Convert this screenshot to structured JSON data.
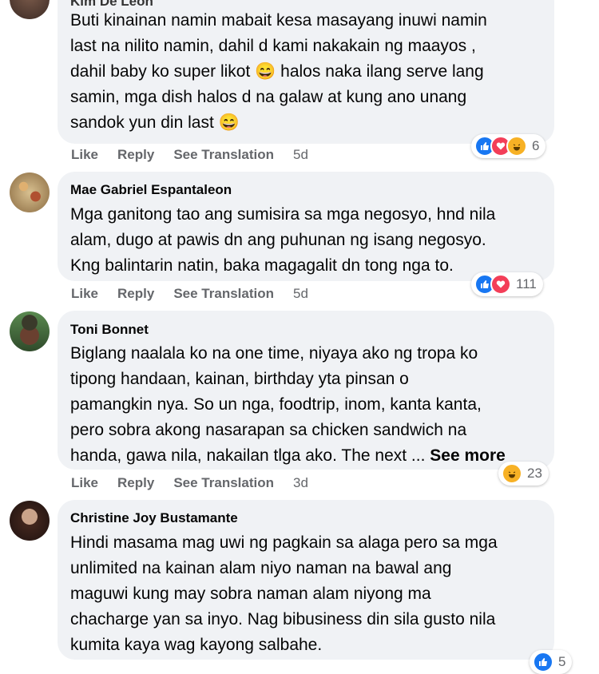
{
  "comments": [
    {
      "author": "Kim De Leon",
      "lines": [
        "Buti kinainan namin mabait kesa masayang inuwi namin",
        "last na nilito namin, dahil d kami nakakain ng maayos ,",
        "dahil baby ko super likot",
        "halos naka ilang serve lang",
        "samin, mga dish halos d na galaw at kung ano unang",
        "sandok yun din last"
      ],
      "like": "Like",
      "reply": "Reply",
      "translate": "See Translation",
      "time": "5d",
      "reactions": [
        "like-icon",
        "love-icon",
        "haha-icon"
      ],
      "count": "6"
    },
    {
      "author": "Mae Gabriel Espantaleon",
      "lines": [
        "Mga ganitong tao ang sumisira sa mga negosyo, hnd nila",
        "alam, dugo at pawis dn ang puhunan ng isang negosyo.",
        "Kng balintarin natin, baka magagalit dn tong nga to."
      ],
      "like": "Like",
      "reply": "Reply",
      "translate": "See Translation",
      "time": "5d",
      "reactions": [
        "like-icon",
        "love-icon"
      ],
      "count": "111"
    },
    {
      "author": "Toni Bonnet",
      "lines": [
        "Biglang naalala ko na one time, niyaya ako ng tropa ko",
        "tipong handaan, kainan, birthday yta pinsan o",
        "pamangkin nya. So un nga, foodtrip, inom, kanta kanta,",
        "pero sobra akong nasarapan sa chicken sandwich na",
        "handa, gawa nila, nakailan tlga ako. The next ..."
      ],
      "see_more": "See more",
      "like": "Like",
      "reply": "Reply",
      "translate": "See Translation",
      "time": "3d",
      "reactions": [
        "haha-icon"
      ],
      "count": "23"
    },
    {
      "author": "Christine Joy Bustamante",
      "lines": [
        "Hindi masama mag uwi ng pagkain sa alaga pero sa mga",
        "unlimited na kainan alam niyo naman na bawal ang",
        "maguwi kung may sobra naman alam niyong ma",
        "chacharge yan sa inyo. Nag bibusiness din sila gusto nila",
        "kumita kaya wag kayong salbahe."
      ],
      "reactions": [
        "like-icon"
      ],
      "count": "5"
    }
  ],
  "colors": {
    "bubble": "#f0f2f5",
    "like": "#1877f2",
    "love": "#f33e58",
    "haha": "#f7b125",
    "meta": "#65676b"
  }
}
